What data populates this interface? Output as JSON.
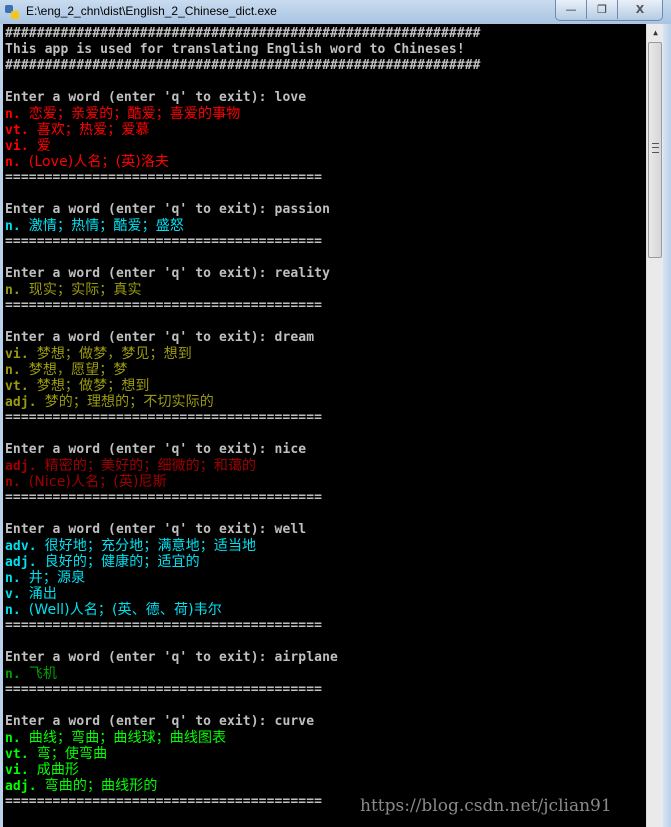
{
  "window": {
    "title": "E:\\eng_2_chn\\dist\\English_2_Chinese_dict.exe",
    "app_icon": "python-icon",
    "controls": {
      "minimize": "—",
      "maximize": "❐",
      "close": "X"
    }
  },
  "console": {
    "header": {
      "border": "############################################################",
      "message": "This app is used for translating English word to Chineses!"
    },
    "prompt": "Enter a word (enter 'q' to exit): ",
    "separator": "========================================",
    "entries": [
      {
        "word": "love",
        "color": "#ff0000",
        "defs": [
          {
            "pos": "n.",
            "text": "恋爱；亲爱的；酷爱；喜爱的事物"
          },
          {
            "pos": "vt.",
            "text": "喜欢；热爱；爱慕"
          },
          {
            "pos": "vi.",
            "text": "爱"
          },
          {
            "pos": "n.",
            "text": "(Love)人名；(英)洛夫"
          }
        ]
      },
      {
        "word": "passion",
        "color": "#00e0f0",
        "defs": [
          {
            "pos": "n.",
            "text": "激情；热情；酷爱；盛怒"
          }
        ]
      },
      {
        "word": "reality",
        "color": "#9a9a10",
        "defs": [
          {
            "pos": "n.",
            "text": "现实；实际；真实"
          }
        ]
      },
      {
        "word": "dream",
        "color": "#9a9a10",
        "defs": [
          {
            "pos": "vi.",
            "text": "梦想；做梦，梦见；想到"
          },
          {
            "pos": "n.",
            "text": "梦想，愿望；梦"
          },
          {
            "pos": "vt.",
            "text": "梦想；做梦；想到"
          },
          {
            "pos": "adj.",
            "text": "梦的；理想的；不切实际的"
          }
        ]
      },
      {
        "word": "nice",
        "color": "#a00000",
        "defs": [
          {
            "pos": "adj.",
            "text": "精密的；美好的；细微的；和蔼的"
          },
          {
            "pos": "n.",
            "text": "(Nice)人名；(英)尼斯"
          }
        ]
      },
      {
        "word": "well",
        "color": "#00e0f0",
        "defs": [
          {
            "pos": "adv.",
            "text": "很好地；充分地；满意地；适当地"
          },
          {
            "pos": "adj.",
            "text": "良好的；健康的；适宜的"
          },
          {
            "pos": "n.",
            "text": "井；源泉"
          },
          {
            "pos": "v.",
            "text": "涌出"
          },
          {
            "pos": "n.",
            "text": "(Well)人名；(英、德、荷)韦尔"
          }
        ]
      },
      {
        "word": "airplane",
        "color": "#00a000",
        "defs": [
          {
            "pos": "n.",
            "text": "飞机"
          }
        ]
      },
      {
        "word": "curve",
        "color": "#00ff00",
        "defs": [
          {
            "pos": "n.",
            "text": "曲线；弯曲；曲线球；曲线图表"
          },
          {
            "pos": "vt.",
            "text": "弯；使弯曲"
          },
          {
            "pos": "vi.",
            "text": "成曲形"
          },
          {
            "pos": "adj.",
            "text": "弯曲的；曲线形的"
          }
        ]
      }
    ]
  },
  "watermark": "https://blog.csdn.net/jclian91"
}
